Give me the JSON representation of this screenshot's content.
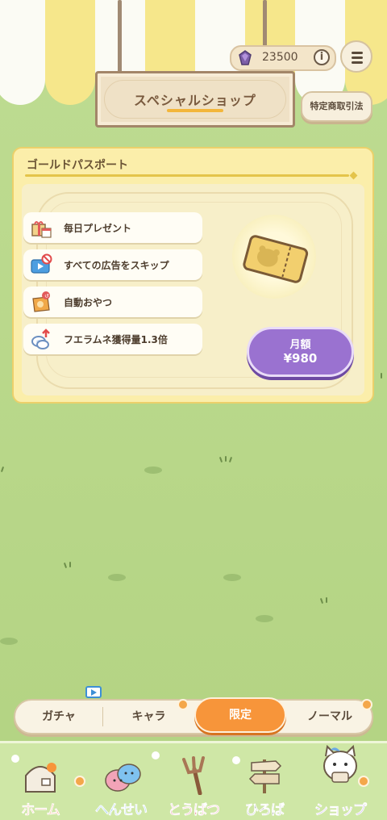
{
  "header": {
    "shop_title": "スペシャルショップ",
    "currency_value": "23500",
    "info_label": "i",
    "legal_button": "特定商取引法"
  },
  "pass_card": {
    "title": "ゴールドパスポート",
    "features": [
      {
        "label": "毎日プレゼント",
        "icon": "gift-calendar-icon"
      },
      {
        "label": "すべての広告をスキップ",
        "icon": "ad-skip-icon"
      },
      {
        "label": "自動おやつ",
        "icon": "auto-snack-icon"
      },
      {
        "label": "フエラムネ獲得量1.3倍",
        "icon": "fueramune-boost-icon"
      }
    ],
    "price_label": "月額",
    "price_value": "¥980"
  },
  "tabs": [
    {
      "label": "ガチャ"
    },
    {
      "label": "キャラ"
    },
    {
      "label": "限定"
    },
    {
      "label": "ノーマル"
    }
  ],
  "active_tab": "限定",
  "nav": [
    {
      "label": "ホーム",
      "color": "#f07a35"
    },
    {
      "label": "へんせい",
      "color": "#4fa3e0"
    },
    {
      "label": "とうばつ",
      "color": "#e35a6c"
    },
    {
      "label": "ひろば",
      "color": "#8a8f95"
    },
    {
      "label": "ショップ",
      "color": "#8a63c8"
    }
  ],
  "colors": {
    "accent_orange": "#f7953a",
    "price_purple": "#9a72d0",
    "card_yellow": "#fbeeaa"
  }
}
